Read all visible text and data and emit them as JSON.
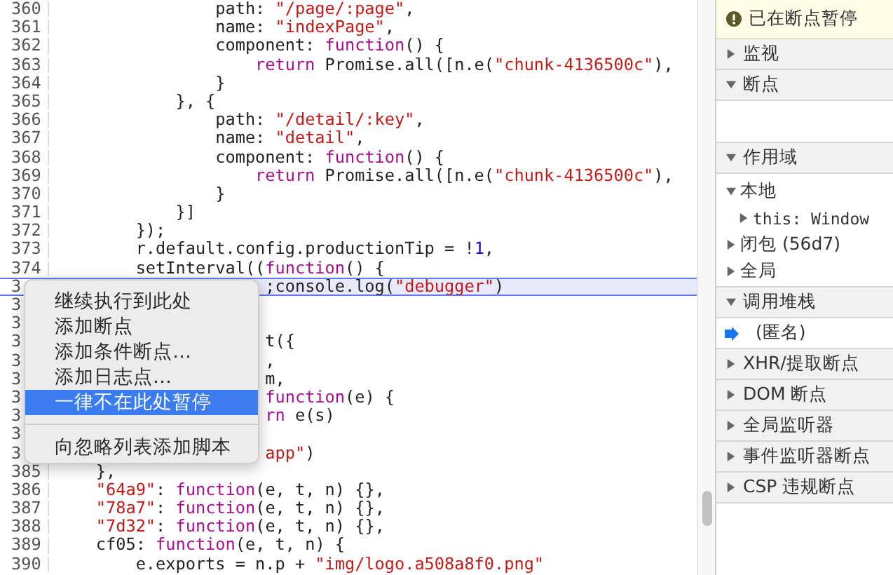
{
  "editor": {
    "lines": [
      {
        "number": "360",
        "current": false,
        "tokens": [
          {
            "kind": "plain",
            "text": "                path: "
          },
          {
            "kind": "string",
            "text": "\"/page/:page\""
          },
          {
            "kind": "plain",
            "text": ","
          }
        ]
      },
      {
        "number": "361",
        "current": false,
        "tokens": [
          {
            "kind": "plain",
            "text": "                name: "
          },
          {
            "kind": "string",
            "text": "\"indexPage\""
          },
          {
            "kind": "plain",
            "text": ","
          }
        ]
      },
      {
        "number": "362",
        "current": false,
        "tokens": [
          {
            "kind": "plain",
            "text": "                component: "
          },
          {
            "kind": "keyword",
            "text": "function"
          },
          {
            "kind": "plain",
            "text": "() {"
          }
        ]
      },
      {
        "number": "363",
        "current": false,
        "tokens": [
          {
            "kind": "keyword",
            "text": "                    return"
          },
          {
            "kind": "plain",
            "text": " Promise.all([n.e("
          },
          {
            "kind": "string",
            "text": "\"chunk-4136500c\""
          },
          {
            "kind": "plain",
            "text": "),"
          }
        ]
      },
      {
        "number": "364",
        "current": false,
        "tokens": [
          {
            "kind": "plain",
            "text": "                }"
          }
        ]
      },
      {
        "number": "365",
        "current": false,
        "tokens": [
          {
            "kind": "plain",
            "text": "            }, {"
          }
        ]
      },
      {
        "number": "366",
        "current": false,
        "tokens": [
          {
            "kind": "plain",
            "text": "                path: "
          },
          {
            "kind": "string",
            "text": "\"/detail/:key\""
          },
          {
            "kind": "plain",
            "text": ","
          }
        ]
      },
      {
        "number": "367",
        "current": false,
        "tokens": [
          {
            "kind": "plain",
            "text": "                name: "
          },
          {
            "kind": "string",
            "text": "\"detail\""
          },
          {
            "kind": "plain",
            "text": ","
          }
        ]
      },
      {
        "number": "368",
        "current": false,
        "tokens": [
          {
            "kind": "plain",
            "text": "                component: "
          },
          {
            "kind": "keyword",
            "text": "function"
          },
          {
            "kind": "plain",
            "text": "() {"
          }
        ]
      },
      {
        "number": "369",
        "current": false,
        "tokens": [
          {
            "kind": "keyword",
            "text": "                    return"
          },
          {
            "kind": "plain",
            "text": " Promise.all([n.e("
          },
          {
            "kind": "string",
            "text": "\"chunk-4136500c\""
          },
          {
            "kind": "plain",
            "text": "),"
          }
        ]
      },
      {
        "number": "370",
        "current": false,
        "tokens": [
          {
            "kind": "plain",
            "text": "                }"
          }
        ]
      },
      {
        "number": "371",
        "current": false,
        "tokens": [
          {
            "kind": "plain",
            "text": "            }]"
          }
        ]
      },
      {
        "number": "372",
        "current": false,
        "tokens": [
          {
            "kind": "plain",
            "text": "        });"
          }
        ]
      },
      {
        "number": "373",
        "current": false,
        "tokens": [
          {
            "kind": "plain",
            "text": "        r.default.config.productionTip = !"
          },
          {
            "kind": "number",
            "text": "1"
          },
          {
            "kind": "plain",
            "text": ","
          }
        ]
      },
      {
        "number": "374",
        "current": false,
        "tokens": [
          {
            "kind": "plain",
            "text": "        setInterval(("
          },
          {
            "kind": "keyword",
            "text": "function"
          },
          {
            "kind": "plain",
            "text": "() {"
          }
        ]
      },
      {
        "number": "3",
        "current": true,
        "tokens": [
          {
            "kind": "plain",
            "text": "                     ;console.log("
          },
          {
            "kind": "string",
            "text": "\"debugger\""
          },
          {
            "kind": "plain",
            "text": ")"
          }
        ]
      },
      {
        "number": "3",
        "current": false
      },
      {
        "number": "3",
        "current": false
      },
      {
        "number": "3",
        "current": false,
        "tokens": [
          {
            "kind": "plain",
            "text": "                     t({"
          }
        ]
      },
      {
        "number": "3",
        "current": false,
        "tokens": [
          {
            "kind": "plain",
            "text": "                     ,"
          }
        ]
      },
      {
        "number": "3",
        "current": false,
        "tokens": [
          {
            "kind": "plain",
            "text": "                     m,"
          }
        ]
      },
      {
        "number": "3",
        "current": false,
        "tokens": [
          {
            "kind": "keyword",
            "text": "                     function"
          },
          {
            "kind": "plain",
            "text": "(e) {"
          }
        ]
      },
      {
        "number": "3",
        "current": false,
        "tokens": [
          {
            "kind": "keyword",
            "text": "                     rn"
          },
          {
            "kind": "plain",
            "text": " e(s)"
          }
        ]
      },
      {
        "number": "3",
        "current": false
      },
      {
        "number": "3",
        "current": false,
        "tokens": [
          {
            "kind": "string",
            "text": "                     app\""
          },
          {
            "kind": "plain",
            "text": ")"
          }
        ]
      },
      {
        "number": "385",
        "current": false,
        "tokens": [
          {
            "kind": "plain",
            "text": "    },"
          }
        ]
      },
      {
        "number": "386",
        "current": false,
        "tokens": [
          {
            "kind": "string",
            "text": "    \"64a9\""
          },
          {
            "kind": "plain",
            "text": ": "
          },
          {
            "kind": "keyword",
            "text": "function"
          },
          {
            "kind": "plain",
            "text": "(e, t, n) {},"
          }
        ]
      },
      {
        "number": "387",
        "current": false,
        "tokens": [
          {
            "kind": "string",
            "text": "    \"78a7\""
          },
          {
            "kind": "plain",
            "text": ": "
          },
          {
            "kind": "keyword",
            "text": "function"
          },
          {
            "kind": "plain",
            "text": "(e, t, n) {},"
          }
        ]
      },
      {
        "number": "388",
        "current": false,
        "tokens": [
          {
            "kind": "string",
            "text": "    \"7d32\""
          },
          {
            "kind": "plain",
            "text": ": "
          },
          {
            "kind": "keyword",
            "text": "function"
          },
          {
            "kind": "plain",
            "text": "(e, t, n) {},"
          }
        ]
      },
      {
        "number": "389",
        "current": false,
        "tokens": [
          {
            "kind": "plain",
            "text": "    cf05: "
          },
          {
            "kind": "keyword",
            "text": "function"
          },
          {
            "kind": "plain",
            "text": "(e, t, n) {"
          }
        ]
      },
      {
        "number": "390",
        "current": false,
        "tokens": [
          {
            "kind": "plain",
            "text": "        e.exports = n.p + "
          },
          {
            "kind": "string",
            "text": "\"img/logo.a508a8f0.png\""
          }
        ]
      }
    ]
  },
  "context_menu": {
    "items": [
      {
        "label": "继续执行到此处",
        "selected": false,
        "separator_before": false
      },
      {
        "label": "添加断点",
        "selected": false,
        "separator_before": false
      },
      {
        "label": "添加条件断点…",
        "selected": false,
        "separator_before": false
      },
      {
        "label": "添加日志点…",
        "selected": false,
        "separator_before": false
      },
      {
        "label": "一律不在此处暂停",
        "selected": true,
        "separator_before": false
      },
      {
        "label": "向忽略列表添加脚本",
        "selected": false,
        "separator_before": true
      }
    ]
  },
  "sidebar": {
    "pause_banner": {
      "text": "已在断点暂停"
    },
    "sections": [
      {
        "title": "监视",
        "expanded": false
      },
      {
        "title": "断点",
        "expanded": true
      },
      {
        "title": "作用域",
        "expanded": true,
        "scope": [
          {
            "label": "本地",
            "kind": "group",
            "expanded": true,
            "children": [
              {
                "label": "this: Window",
                "kind": "property",
                "expanded": false
              }
            ]
          },
          {
            "label": "闭包 (56d7)",
            "kind": "group",
            "expanded": false
          },
          {
            "label": "全局",
            "kind": "group",
            "expanded": false
          }
        ]
      },
      {
        "title": "调用堆栈",
        "expanded": true,
        "frames": [
          {
            "label": "(匿名)",
            "selected": true
          }
        ]
      },
      {
        "title": "XHR/提取断点",
        "expanded": false
      },
      {
        "title": "DOM 断点",
        "expanded": false
      },
      {
        "title": "全局监听器",
        "expanded": false
      },
      {
        "title": "事件监听器断点",
        "expanded": false
      },
      {
        "title": "CSP 违规断点",
        "expanded": false
      }
    ]
  }
}
